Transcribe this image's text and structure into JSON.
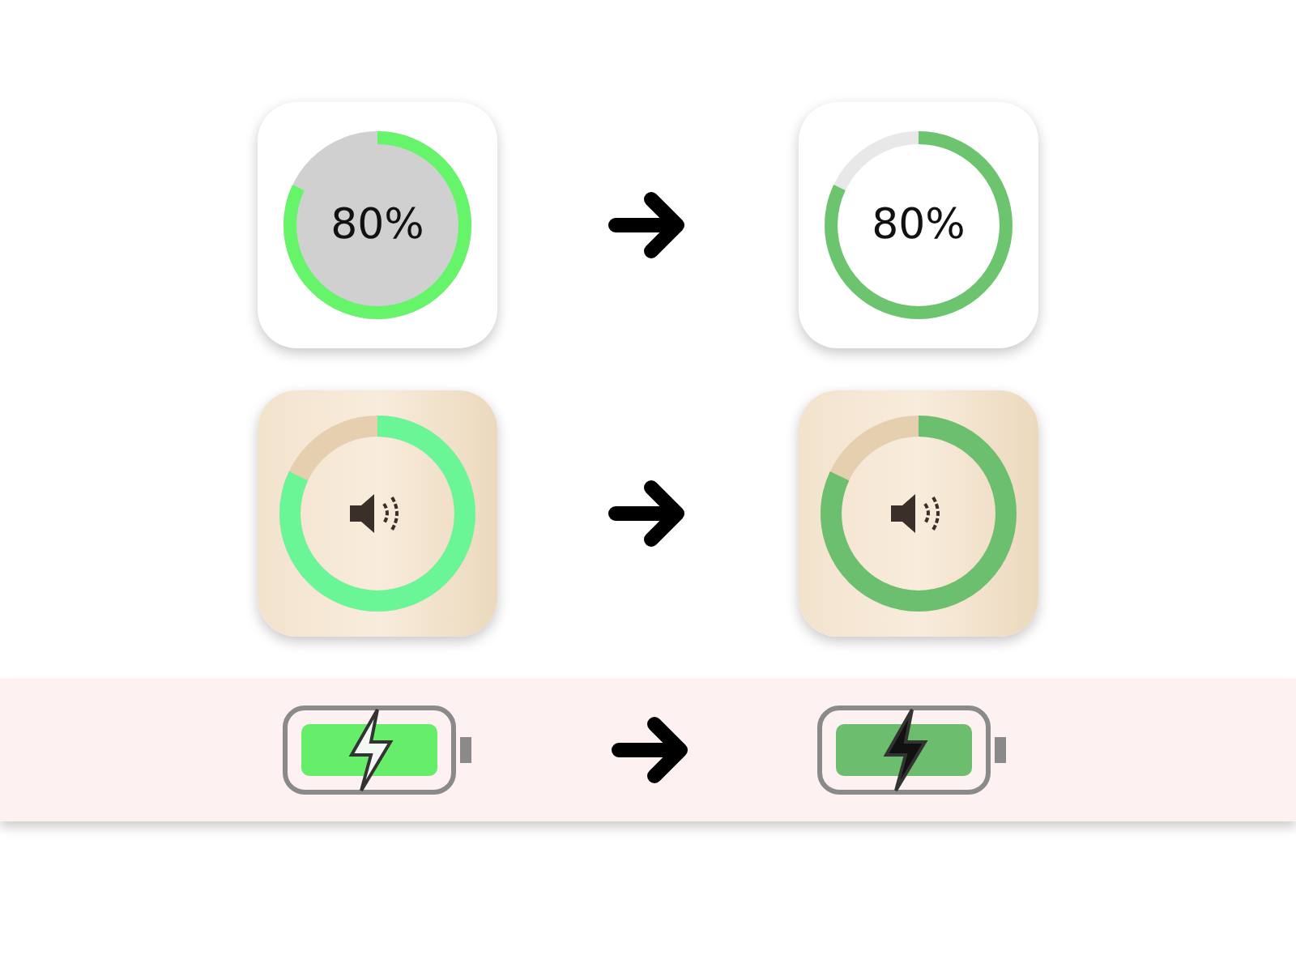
{
  "rows": [
    {
      "kind": "percent",
      "before": {
        "label": "80%"
      },
      "after": {
        "label": "80%"
      }
    },
    {
      "kind": "volume"
    },
    {
      "kind": "battery"
    }
  ]
}
